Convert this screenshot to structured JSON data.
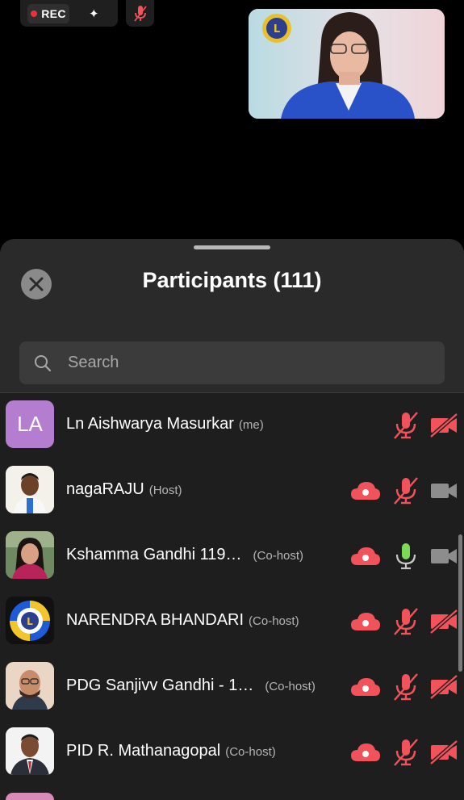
{
  "top_bar": {
    "rec_label": "REC"
  },
  "sheet": {
    "title": "Participants (111)",
    "search_placeholder": "Search"
  },
  "participants": [
    {
      "name": "Ln Aishwarya Masurkar",
      "role": "(me)",
      "initials": "LA",
      "avatar_color": "#b57dd0",
      "cloud": false,
      "mic": "muted",
      "video": "off"
    },
    {
      "name": "nagaRAJU",
      "role": "(Host)",
      "cloud": true,
      "mic": "muted",
      "video": "no-status"
    },
    {
      "name": "Kshamma Gandhi 119…",
      "role": "(Co-host)",
      "cloud": true,
      "mic": "on",
      "video": "no-status"
    },
    {
      "name": "NARENDRA BHANDARI",
      "role": "(Co-host)",
      "cloud": true,
      "mic": "muted",
      "video": "off"
    },
    {
      "name": "PDG Sanjivv Gandhi - 1…",
      "role": "(Co-host)",
      "cloud": true,
      "mic": "muted",
      "video": "off"
    },
    {
      "name": "PID R. Mathanagopal",
      "role": "(Co-host)",
      "cloud": true,
      "mic": "muted",
      "video": "off"
    }
  ],
  "colors": {
    "accent_red": "#f2525a",
    "mic_on_green": "#7ed957",
    "sheet_bg": "#2a2a2a",
    "list_bg": "#1e1e1e"
  }
}
